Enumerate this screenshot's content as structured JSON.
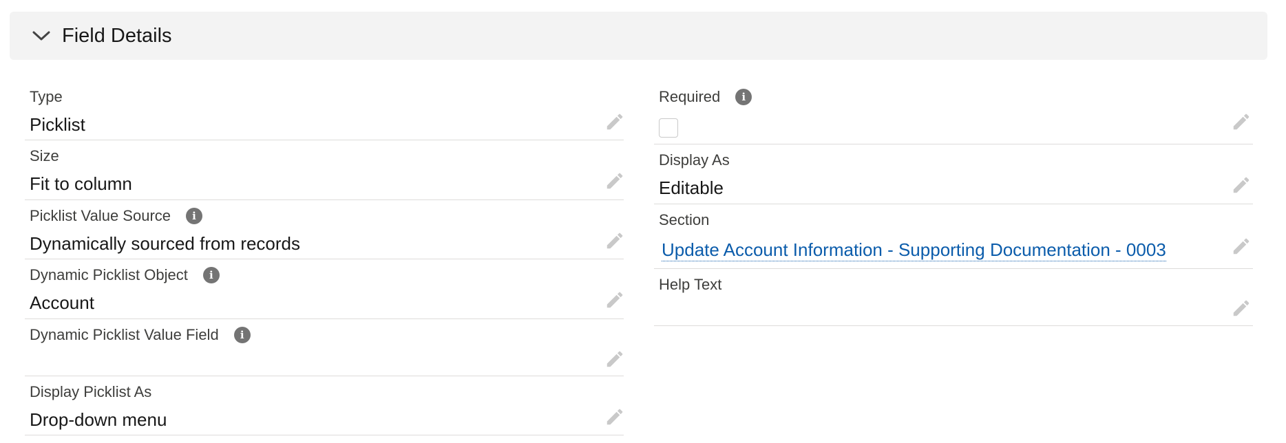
{
  "section": {
    "title": "Field Details",
    "icon": "chevron-down-icon"
  },
  "left_fields": [
    {
      "label": "Type",
      "value": "Picklist",
      "has_info": false
    },
    {
      "label": "Size",
      "value": "Fit to column",
      "has_info": false
    },
    {
      "label": "Picklist Value Source",
      "value": "Dynamically sourced from records",
      "has_info": true
    },
    {
      "label": "Dynamic Picklist Object",
      "value": "Account",
      "has_info": true
    },
    {
      "label": "Dynamic Picklist Value Field",
      "value": "",
      "has_info": true
    },
    {
      "label": "Display Picklist As",
      "value": "Drop-down menu",
      "has_info": false
    }
  ],
  "right_fields": [
    {
      "label": "Required",
      "value": "",
      "has_info": true,
      "checkbox_checked": false
    },
    {
      "label": "Display As",
      "value": "Editable",
      "has_info": false
    },
    {
      "label": "Section",
      "value": "Update Account Information - Supporting Documentation - 0003",
      "has_info": false,
      "is_link": true
    },
    {
      "label": "Help Text",
      "value": "",
      "has_info": false
    }
  ],
  "icons": {
    "info": "i",
    "edit": "pencil-icon"
  },
  "colors": {
    "header_bg": "#f3f3f3",
    "link": "#0b5cab",
    "label": "#3e3e3c",
    "info_icon": "#747474",
    "edit_icon": "#c9c9c9",
    "divider": "#dddbda"
  }
}
